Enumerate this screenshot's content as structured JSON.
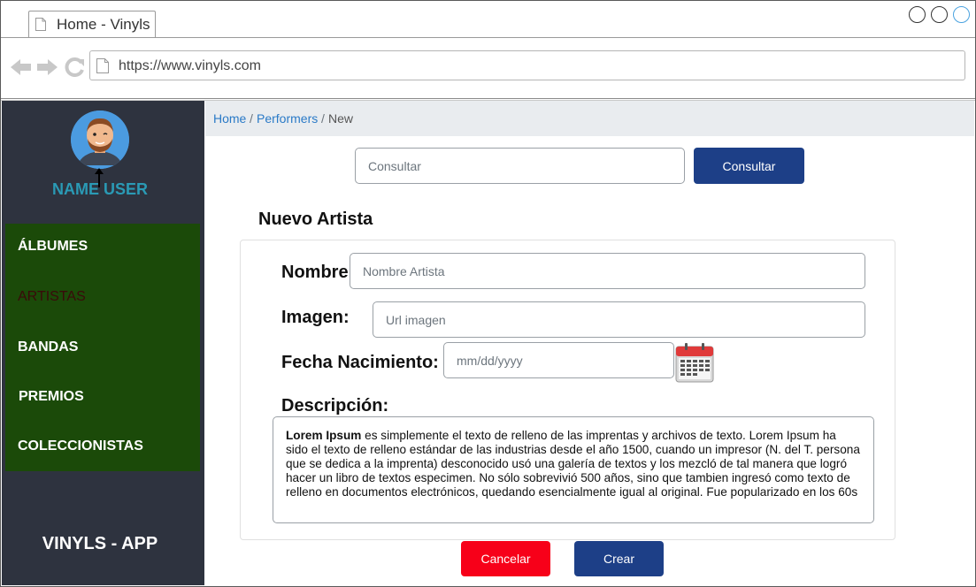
{
  "browser": {
    "tab_title": "Home - Vinyls",
    "url": "https://www.vinyls.com"
  },
  "sidebar": {
    "user_name": "NAME USER",
    "items": [
      {
        "label": "ÁLBUMES",
        "active": false
      },
      {
        "label": "ARTISTAS",
        "active": true
      },
      {
        "label": "BANDAS",
        "active": false
      },
      {
        "label": "PREMIOS",
        "active": false
      },
      {
        "label": "COLECCIONISTAS",
        "active": false
      }
    ],
    "app_name": "VINYLS - APP",
    "menu_color": "#1b4a09",
    "bg_color": "#2e333f"
  },
  "breadcrumb": {
    "home": "Home",
    "sep1": "/",
    "performers": "Performers",
    "sep2": "/",
    "current": "New"
  },
  "search": {
    "placeholder": "Consultar",
    "button_label": "Consultar"
  },
  "form": {
    "title": "Nuevo Artista",
    "name_label": "Nombre",
    "name_placeholder": "Nombre Artista",
    "image_label": "Imagen:",
    "image_placeholder": "Url imagen",
    "birth_label": "Fecha Nacimiento:",
    "birth_placeholder": "mm/dd/yyyy",
    "description_label": "Descripción:",
    "description_bold": "Lorem Ipsum",
    "description_text": " es simplemente el texto de relleno de las imprentas y archivos de texto. Lorem Ipsum ha sido el texto de relleno estándar de las industrias desde el año 1500, cuando un impresor (N. del T. persona que se dedica a la imprenta) desconocido usó una galería de textos y los mezcló de tal manera que logró hacer un libro de textos especimen. No sólo sobrevivió 500 años, sino que tambien ingresó como texto de relleno en documentos electrónicos, quedando esencialmente igual al original. Fue popularizado en los 60s"
  },
  "actions": {
    "cancel_label": "Cancelar",
    "create_label": "Crear",
    "cancel_color": "#f70019",
    "primary_color": "#1d3f87"
  }
}
